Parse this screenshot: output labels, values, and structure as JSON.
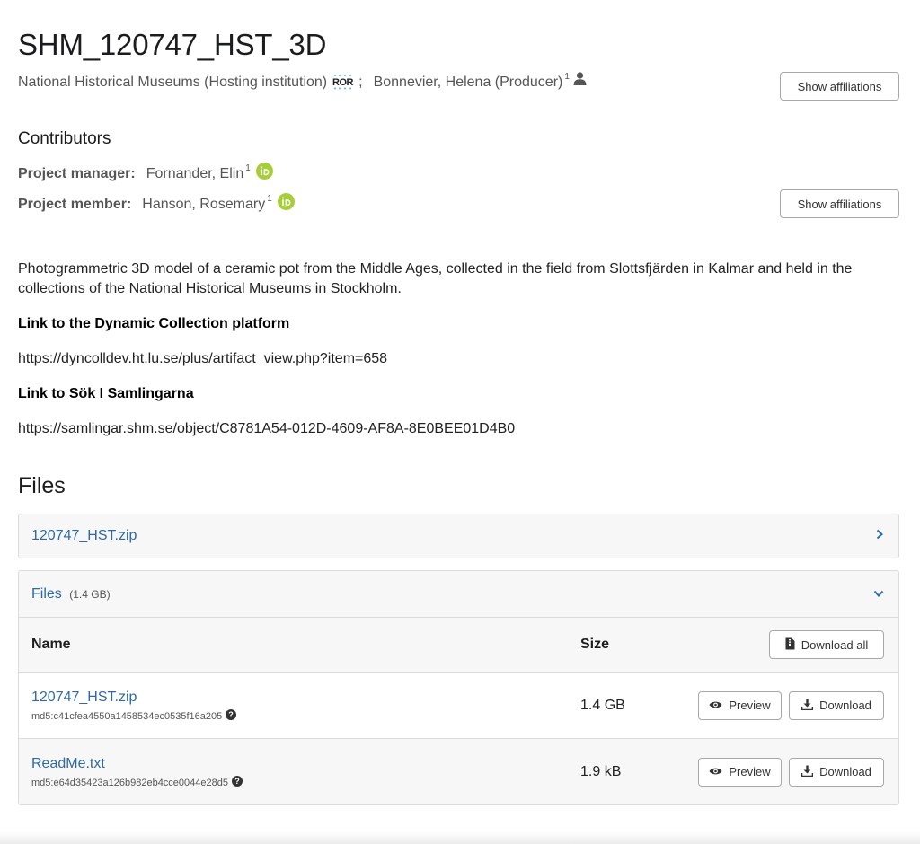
{
  "record": {
    "title": "SHM_120747_HST_3D",
    "creators": [
      {
        "name": "National Historical Museums (Hosting institution)",
        "icon": "ror-icon",
        "separator": ";"
      },
      {
        "name": "Bonnevier, Helena (Producer)",
        "affiliation_ref": "1",
        "icon": "person-icon"
      }
    ],
    "show_affiliations_label": "Show affiliations"
  },
  "contributors": {
    "heading": "Contributors",
    "items": [
      {
        "role": "Project manager:",
        "name": "Fornander, Elin",
        "affiliation_ref": "1",
        "icon": "orcid-icon"
      },
      {
        "role": "Project member:",
        "name": "Hanson, Rosemary",
        "affiliation_ref": "1",
        "icon": "orcid-icon"
      }
    ],
    "show_affiliations_label": "Show affiliations"
  },
  "description": {
    "paragraph": "Photogrammetric 3D model of a ceramic pot from the Middle Ages, collected in the field from Slottsfjärden in Kalmar and held in the collections of the National Historical Museums in Stockholm.",
    "dynamic_heading": "Link to the Dynamic Collection platform",
    "dynamic_url": "https://dyncolldev.ht.lu.se/plus/artifact_view.php?item=658",
    "sok_heading": "Link to Sök I Samlingarna",
    "sok_url": "https://samlingar.shm.se/object/C8781A54-012D-4609-AF8A-8E0BEE01D4B0"
  },
  "files": {
    "heading": "Files",
    "archive_panel": {
      "label": "120747_HST.zip",
      "icon": "chevron-right-icon"
    },
    "files_panel": {
      "label": "Files",
      "size": "(1.4 GB)",
      "icon": "chevron-down-icon"
    },
    "table": {
      "col_name": "Name",
      "col_size": "Size",
      "download_all_label": "Download all",
      "rows": [
        {
          "name": "120747_HST.zip",
          "md5": "md5:c41cfea4550a1458534ec0535f16a205",
          "size": "1.4 GB",
          "preview_label": "Preview",
          "download_label": "Download"
        },
        {
          "name": "ReadMe.txt",
          "md5": "md5:e64d35423a126b982eb4cce0044e28d5",
          "size": "1.9 kB",
          "preview_label": "Preview",
          "download_label": "Download"
        }
      ]
    }
  },
  "colors": {
    "link": "#2e6aa6",
    "orcid": "#a6ce39",
    "border": "#dcdcdc",
    "panel_bg": "#f7f7f7"
  }
}
